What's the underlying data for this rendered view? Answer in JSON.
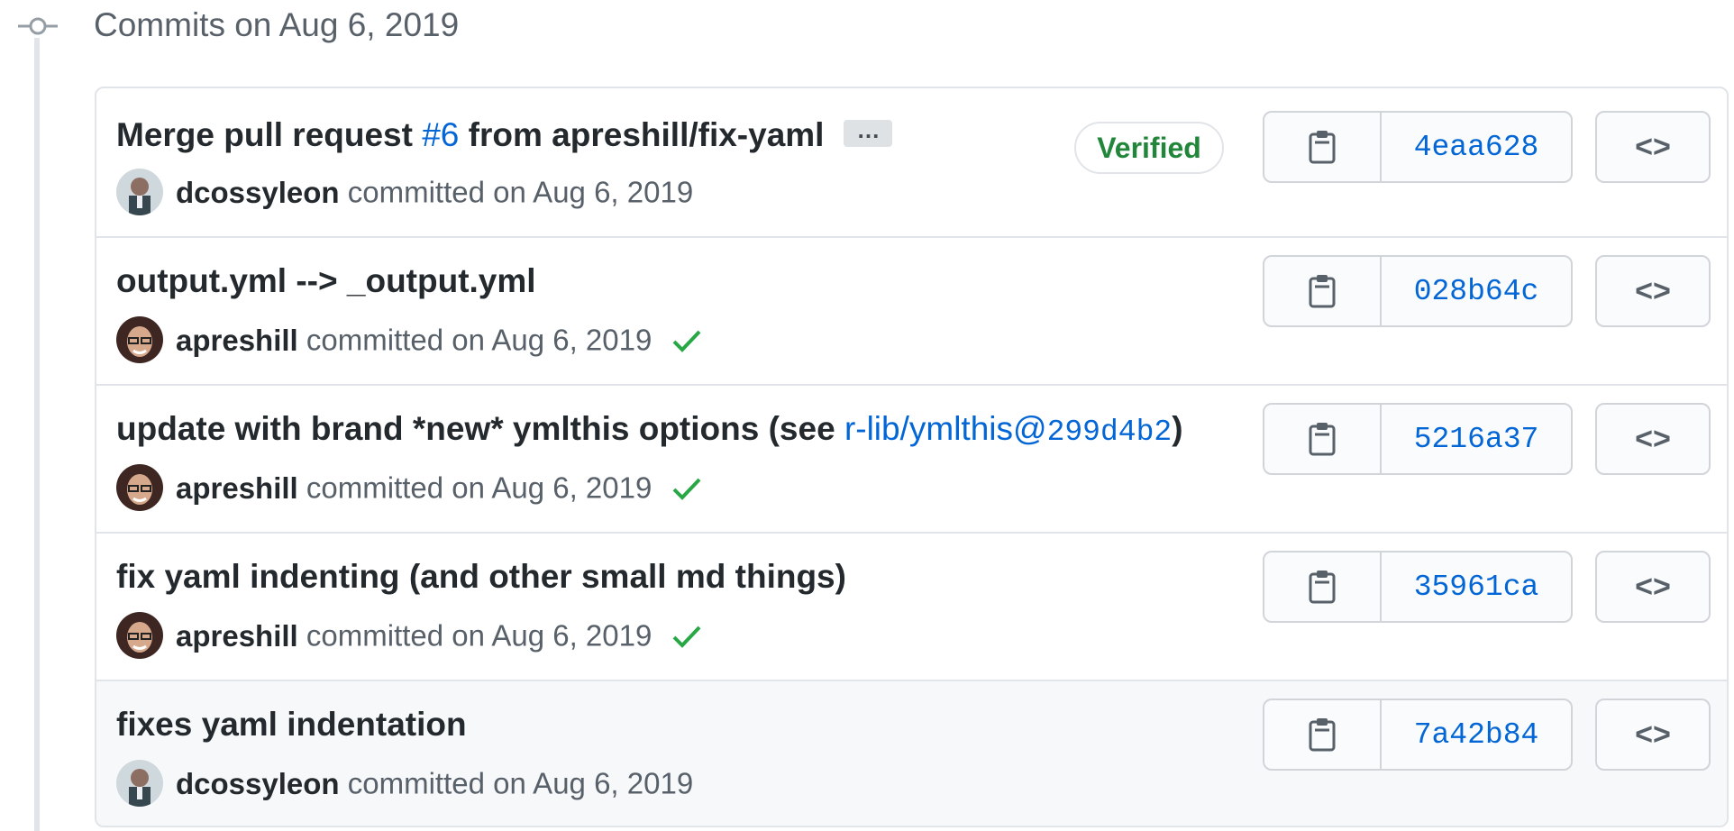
{
  "timeline": {
    "title": "Commits on Aug 6, 2019"
  },
  "commits": [
    {
      "message_pre": "Merge pull request ",
      "message_link": "#6",
      "message_post": " from apreshill/fix-yaml",
      "ellipsis": "…",
      "author": "dcossyleon",
      "committed_text": "committed on Aug 6, 2019",
      "verified": "Verified",
      "sha": "4eaa628",
      "browse_label": "<>"
    },
    {
      "message": "output.yml --> _output.yml",
      "author": "apreshill",
      "committed_text": "committed on Aug 6, 2019",
      "sha": "028b64c",
      "browse_label": "<>"
    },
    {
      "message_pre": "update with brand *new* ymlthis options (see ",
      "message_link_text": "r-lib/ymlthis@",
      "message_link_sha": "299d4b2",
      "message_post": ")",
      "author": "apreshill",
      "committed_text": "committed on Aug 6, 2019",
      "sha": "5216a37",
      "browse_label": "<>"
    },
    {
      "message": "fix yaml indenting (and other small md things)",
      "author": "apreshill",
      "committed_text": "committed on Aug 6, 2019",
      "sha": "35961ca",
      "browse_label": "<>"
    },
    {
      "message": "fixes yaml indentation",
      "author": "dcossyleon",
      "committed_text": "committed on Aug 6, 2019",
      "sha": "7a42b84",
      "browse_label": "<>"
    }
  ],
  "colors": {
    "link": "#0366d6",
    "verified": "#22863a",
    "check": "#28a745",
    "highlight_row": "#f6f8fa"
  },
  "icons": {
    "copy": "clippy-icon",
    "browse": "code-icon",
    "status": "check-icon",
    "timeline": "git-commit-icon"
  }
}
